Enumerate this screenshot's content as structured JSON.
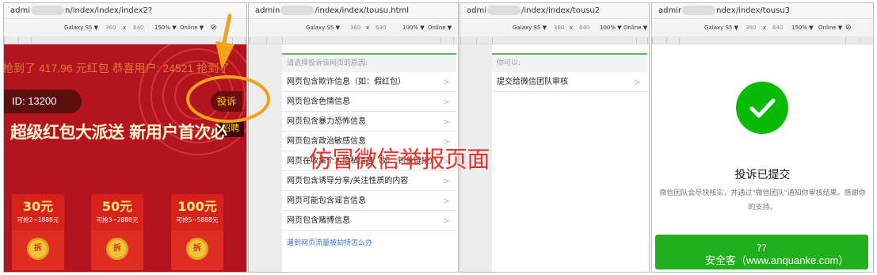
{
  "panel1": {
    "url_prefix": "admi",
    "url_suffix": "n/index/index/index2?",
    "device": "Galaxy S5 ▼",
    "width": "360",
    "times": "x",
    "height": "640",
    "zoom": "150% ▼",
    "network": "Online ▼",
    "marquee": "抢到了 417.96 元红包 恭喜用户: 24521 抢到了",
    "id_label": "ID: 13200",
    "complain_label": "投诉",
    "recruit_label": "招聘",
    "headline": "超级红包大派送 新用户首次必",
    "cards": [
      {
        "amount": "30元",
        "range": "可抢2~1888元",
        "coin": "拆"
      },
      {
        "amount": "50元",
        "range": "可抢3~2888元",
        "coin": "拆"
      },
      {
        "amount": "100元",
        "range": "可抢5~5888元",
        "coin": "拆"
      }
    ]
  },
  "panel2": {
    "url_prefix": "admin",
    "url_suffix": "/index/index/tousu.html",
    "device": "Galaxy S5 ▼",
    "width": "360",
    "times": "x",
    "height": "640",
    "zoom": "100% ▼",
    "network": "Online ▼",
    "hint": "请选择投诉该网页的原因:",
    "reasons": [
      "网页包含欺诈信息（如：假红包）",
      "网页包含色情信息",
      "网页包含暴力恐怖信息",
      "网页包含政治敏感信息",
      "网页在收集个人隐私信息（如：钓鱼链接）",
      "网页包含诱导分享/关注性质的内容",
      "网页可能包含谣言信息",
      "网页包含赌博信息"
    ],
    "hijack_link": "遇到网页流量被劫持怎么办"
  },
  "panel3": {
    "url_prefix": "admi",
    "url_suffix": "/index/index/tousu2",
    "device": "Galaxy S5 ▼",
    "width": "360",
    "times": "x",
    "height": "640",
    "zoom": "100% ▼",
    "network": "Online ▼",
    "hint": "你可以:",
    "action": "提交给微信团队审核"
  },
  "panel4": {
    "url_prefix": "admir",
    "url_suffix": "ndex/index/tousu3",
    "device": "Galaxy S5 ▼",
    "width": "360",
    "times": "x",
    "height": "640",
    "zoom": "150% ▼",
    "network": "Online ▼",
    "done_title": "投诉已提交",
    "done_msg": "微信团队会尽快核实，并通过\"微信团队\"通知你审核结果。感谢你的支持。",
    "button_label": "??"
  },
  "overlay_title": "仿冒微信举报页面",
  "watermark": "安全客（www.anquanke.com）",
  "colors": {
    "accent_red": "#b3141d",
    "wechat_green": "#09bb07",
    "overlay_red": "#e8332a",
    "highlight_orange": "#f0a21a"
  }
}
